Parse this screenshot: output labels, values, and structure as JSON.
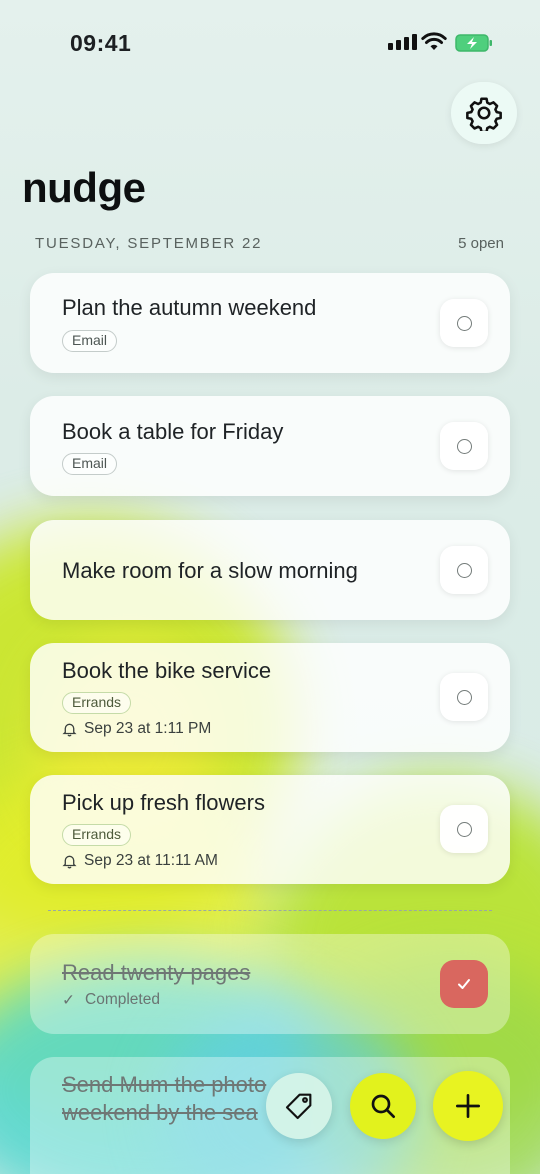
{
  "status_bar": {
    "time": "09:41"
  },
  "header": {
    "app_title": "nudge",
    "date": "TUESDAY, SEPTEMBER 22",
    "open_count": "5 open"
  },
  "tasks": [
    {
      "title": "Plan the autumn weekend",
      "tag": "Email"
    },
    {
      "title": "Book a table for Friday",
      "tag": "Email"
    },
    {
      "title": "Make room for a slow morning"
    },
    {
      "title": "Book the bike service",
      "tag": "Errands",
      "reminder": "Sep 23 at 1:11 PM"
    },
    {
      "title": "Pick up fresh flowers",
      "tag": "Errands",
      "reminder": "Sep 23 at 11:11 AM"
    }
  ],
  "completed": [
    {
      "title": "Read twenty pages",
      "status": "Completed"
    },
    {
      "title_line1": "Send Mum the photo",
      "title_line2": "weekend by the sea"
    }
  ],
  "colors": {
    "accent": "#e8f321",
    "done_check": "#d9675f"
  },
  "icons": {
    "settings": "gear-icon",
    "tag": "tag-icon",
    "search": "search-icon",
    "add": "plus-icon",
    "reminder": "bell-icon",
    "completed": "checkmark-icon"
  }
}
